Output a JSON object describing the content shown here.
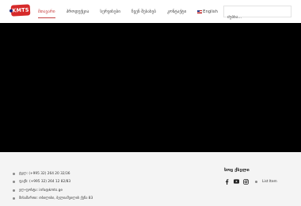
{
  "header": {
    "logo_text": "KMTS",
    "nav": [
      {
        "label": "მთავარი",
        "active": true
      },
      {
        "label": "პროდუქცია",
        "active": false
      },
      {
        "label": "სერვისები",
        "active": false
      },
      {
        "label": "ჩვენ შესახებ",
        "active": false
      },
      {
        "label": "კონტაქტი",
        "active": false
      }
    ],
    "language_label": "English",
    "search_placeholder": "ძებნა..."
  },
  "footer": {
    "contacts": [
      {
        "icon": "phone-icon",
        "text": "ტელ: (+995 32) 264 20 32/36"
      },
      {
        "icon": "phone-icon",
        "text": "ფაქს: (+995 32) 264 12 82/83"
      },
      {
        "icon": "mail-icon",
        "text": "ელ-ფოსტა: info@kmts.ge"
      },
      {
        "icon": "location-icon",
        "text": "მისამართი: თბილისი, ბელიაშვილის ქუჩა 83"
      }
    ],
    "follow_title": "სოც ქსელი",
    "social_icons": [
      "facebook-icon",
      "youtube-icon",
      "instagram-icon"
    ],
    "list_item_label": "List Item"
  },
  "colors": {
    "accent": "#c74242",
    "logo_bg": "#d62a2a",
    "hero_bg": "#000000",
    "footer_bg": "#f4f4f4"
  }
}
